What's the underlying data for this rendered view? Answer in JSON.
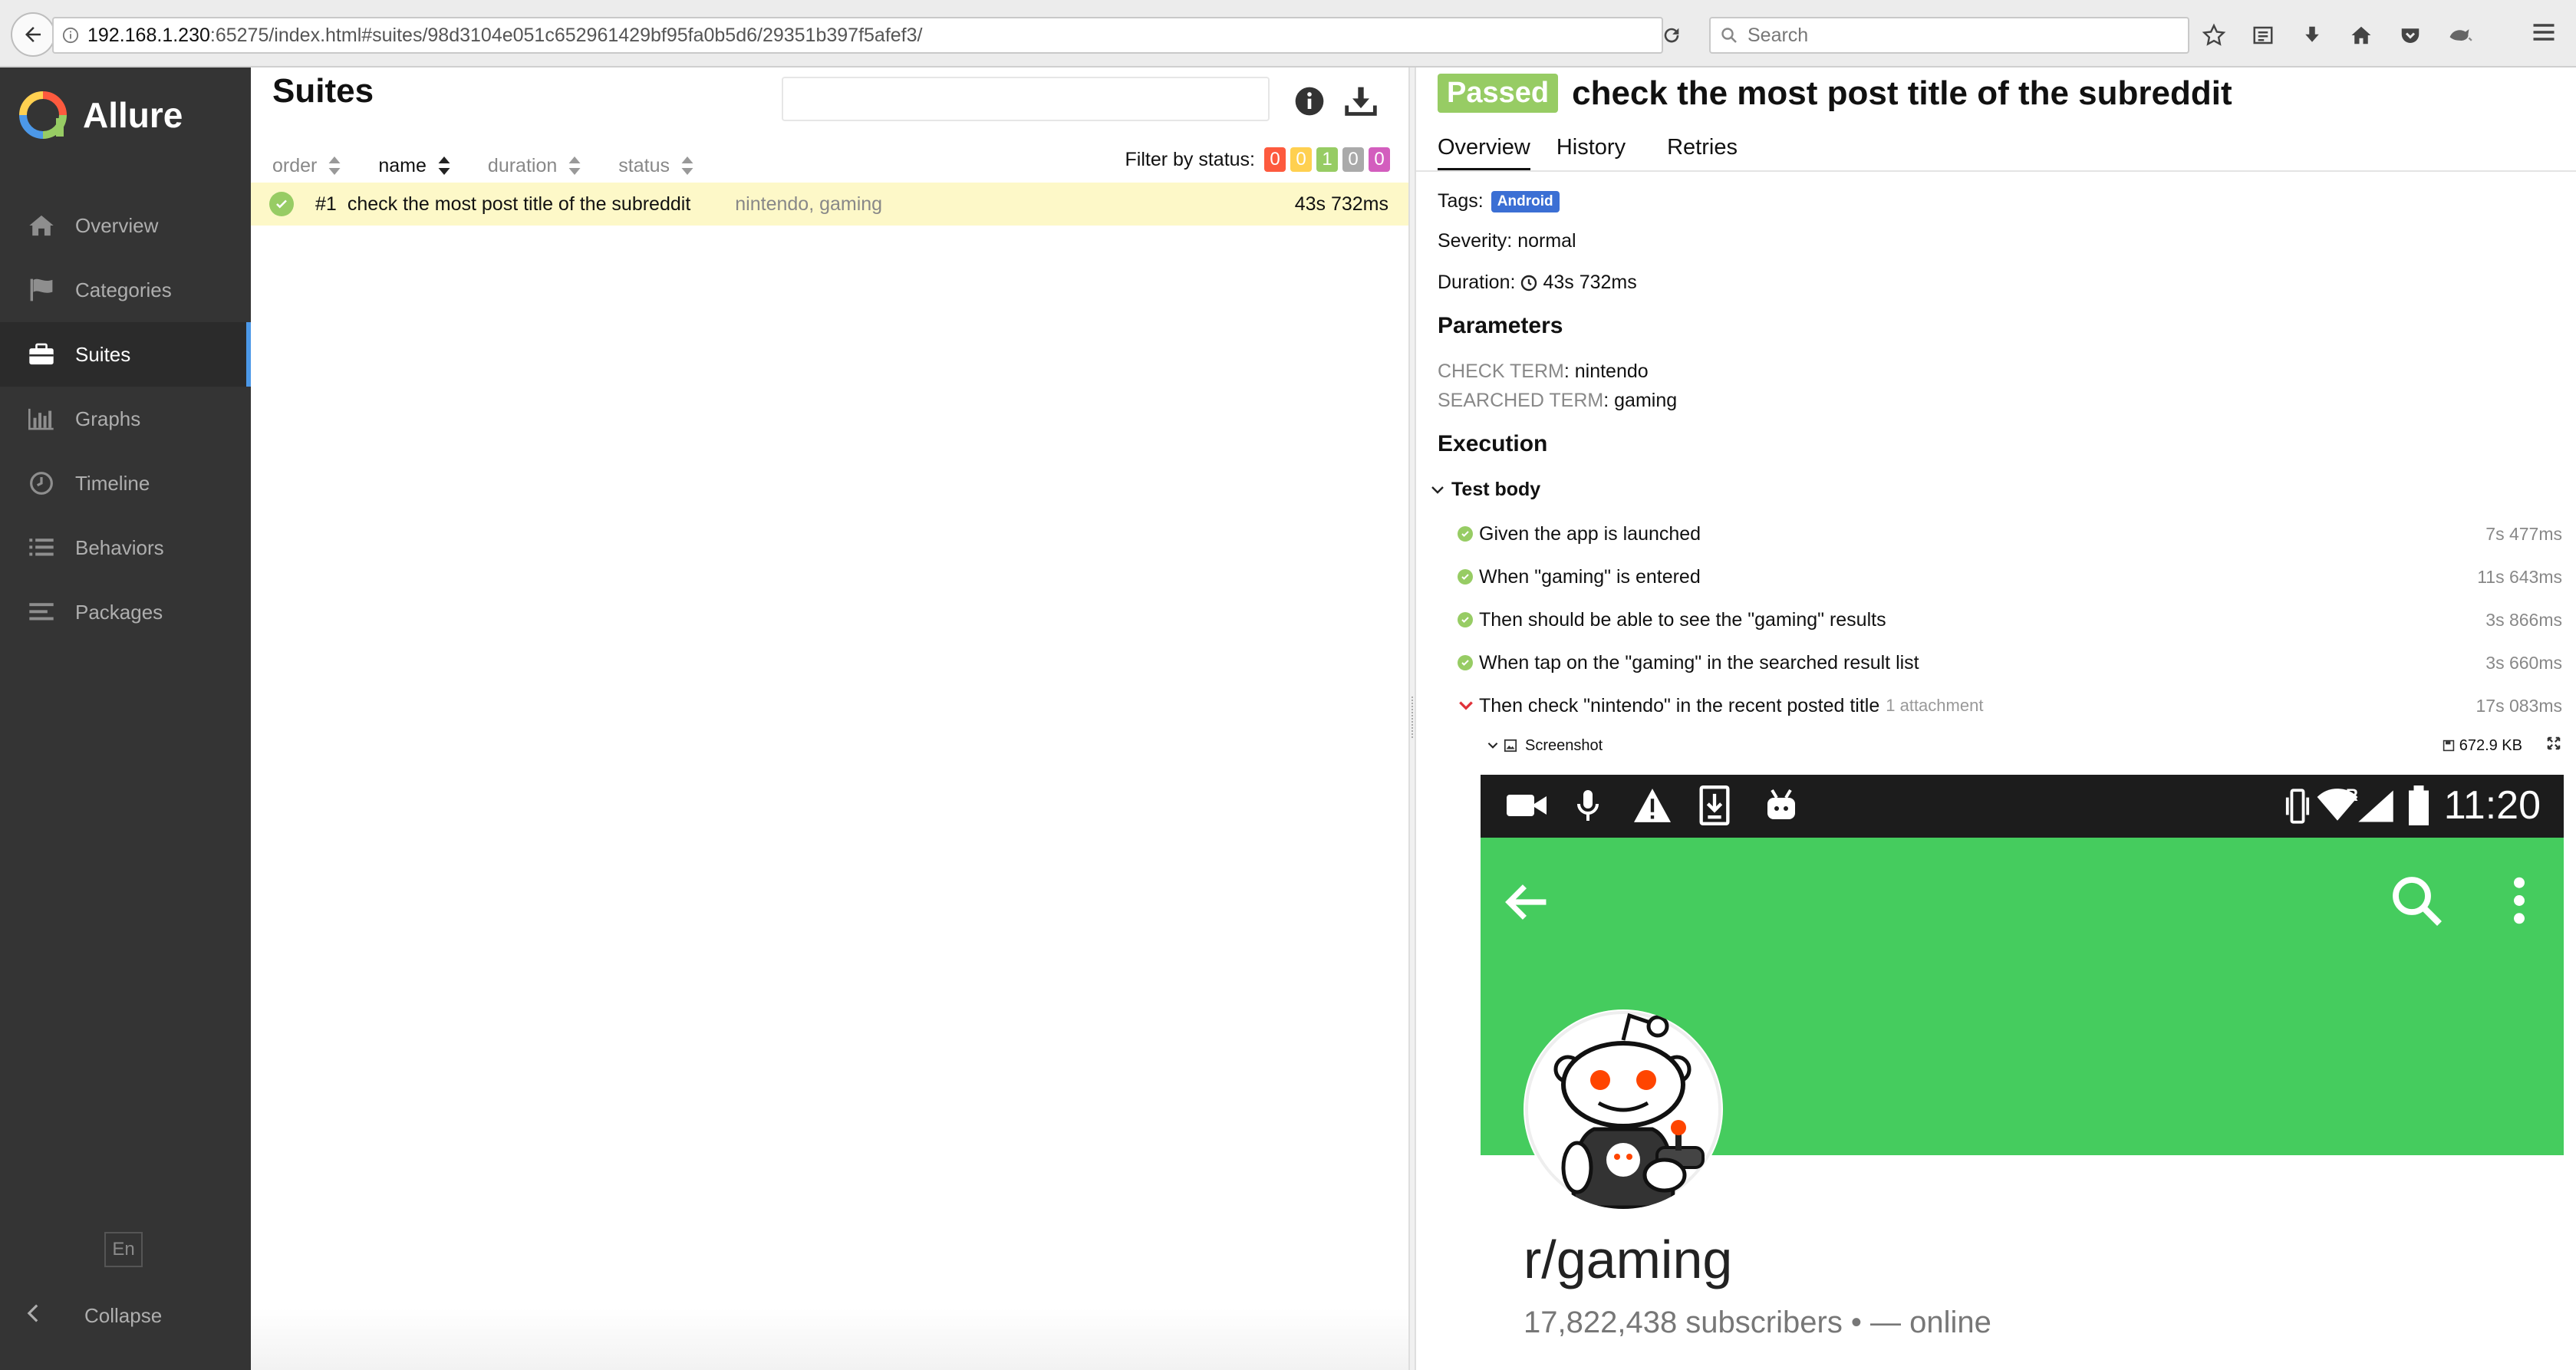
{
  "browser": {
    "url_host": "192.168.1.230",
    "url_rest": ":65275/index.html#suites/98d3104e051c652961429bf95fa0b5d6/29351b397f5afef3/",
    "search_placeholder": "Search"
  },
  "sidebar": {
    "brand": "Allure",
    "items": [
      {
        "label": "Overview",
        "icon": "home-icon"
      },
      {
        "label": "Categories",
        "icon": "flag-icon"
      },
      {
        "label": "Suites",
        "icon": "briefcase-icon",
        "active": true
      },
      {
        "label": "Graphs",
        "icon": "bar-chart-icon"
      },
      {
        "label": "Timeline",
        "icon": "clock-icon"
      },
      {
        "label": "Behaviors",
        "icon": "list-icon"
      },
      {
        "label": "Packages",
        "icon": "align-left-icon"
      }
    ],
    "language": "En",
    "collapse_label": "Collapse"
  },
  "suites": {
    "title": "Suites",
    "columns": [
      "order",
      "name",
      "duration",
      "status"
    ],
    "active_column": "name",
    "filter_label": "Filter by status:",
    "status_counts": [
      {
        "value": "0",
        "color": "#fd5a3e"
      },
      {
        "value": "0",
        "color": "#ffd050"
      },
      {
        "value": "1",
        "color": "#97cc64"
      },
      {
        "value": "0",
        "color": "#aaaaaa"
      },
      {
        "value": "0",
        "color": "#d35ebe"
      }
    ],
    "rows": [
      {
        "order": "#1",
        "name": "check the most post title of the subreddit",
        "params": "nintendo, gaming",
        "duration": "43s 732ms",
        "status": "passed"
      }
    ]
  },
  "detail": {
    "status_badge": "Passed",
    "title": "check the most post title of the subreddit",
    "tabs": [
      "Overview",
      "History",
      "Retries"
    ],
    "tags_label": "Tags:",
    "tag": "Android",
    "severity": "Severity: normal",
    "duration_label": "Duration:",
    "duration": "43s 732ms",
    "parameters_heading": "Parameters",
    "parameters": [
      {
        "key": "CHECK TERM",
        "value": "nintendo"
      },
      {
        "key": "SEARCHED TERM",
        "value": "gaming"
      }
    ],
    "execution_heading": "Execution",
    "test_body_label": "Test body",
    "steps": [
      {
        "text": "Given the app is launched",
        "duration": "7s 477ms",
        "state": "passed"
      },
      {
        "text": "When \"gaming\" is entered",
        "duration": "11s 643ms",
        "state": "passed"
      },
      {
        "text": "Then should be able to see the \"gaming\" results",
        "duration": "3s 866ms",
        "state": "passed"
      },
      {
        "text": "When tap on the \"gaming\" in the searched result list",
        "duration": "3s 660ms",
        "state": "passed"
      },
      {
        "text": "Then check \"nintendo\" in the recent posted title",
        "duration": "17s 083ms",
        "state": "expanded",
        "attachments": "1 attachment"
      }
    ],
    "attachment": {
      "name": "Screenshot",
      "size": "672.9 KB"
    },
    "screenshot": {
      "time": "11:20",
      "network_letter": "R",
      "subreddit": "r/gaming",
      "stats": "17,822,438 subscribers • — online"
    }
  },
  "colors": {
    "sidebar_bg": "#343434",
    "accent": "#4c98e8",
    "passed": "#97cc64",
    "row_highlight": "#fdf8c8",
    "reddit_green": "#45cc5e",
    "tag_blue": "#3b6fd4"
  }
}
